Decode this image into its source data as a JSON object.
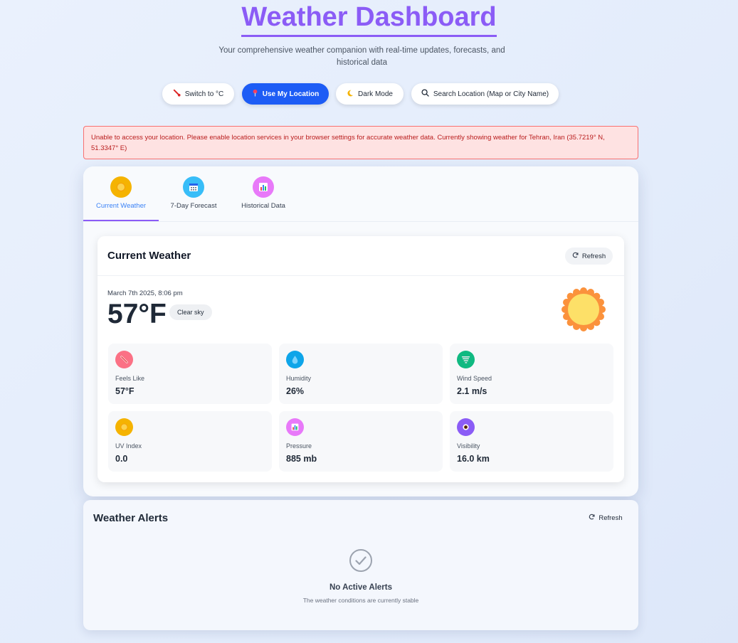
{
  "header": {
    "title": "Weather Dashboard",
    "subtitle": "Your comprehensive weather companion with real-time updates, forecasts, and historical data"
  },
  "toolbar": {
    "switch_unit_label": "Switch to °C",
    "use_location_label": "Use My Location",
    "dark_mode_label": "Dark Mode",
    "search_label": "Search Location (Map or City Name)"
  },
  "error_message": "Unable to access your location. Please enable location services in your browser settings for accurate weather data. Currently showing weather for Tehran, Iran (35.7219° N, 51.3347° E)",
  "tabs": [
    {
      "label": "Current Weather",
      "icon": "sun-icon",
      "active": true
    },
    {
      "label": "7-Day Forecast",
      "icon": "calendar-icon",
      "active": false
    },
    {
      "label": "Historical Data",
      "icon": "bar-chart-icon",
      "active": false
    }
  ],
  "current": {
    "title": "Current Weather",
    "refresh_label": "Refresh",
    "datetime": "March 7th 2025, 8:06 pm",
    "temperature": "57°F",
    "condition": "Clear sky",
    "stats": [
      {
        "label": "Feels Like",
        "value": "57°F",
        "icon": "thermometer-icon"
      },
      {
        "label": "Humidity",
        "value": "26%",
        "icon": "droplet-icon"
      },
      {
        "label": "Wind Speed",
        "value": "2.1 m/s",
        "icon": "tornado-icon"
      },
      {
        "label": "UV Index",
        "value": "0.0",
        "icon": "sun-icon"
      },
      {
        "label": "Pressure",
        "value": "885 mb",
        "icon": "bar-chart-icon"
      },
      {
        "label": "Visibility",
        "value": "16.0 km",
        "icon": "eye-icon"
      }
    ]
  },
  "alerts": {
    "title": "Weather Alerts",
    "refresh_label": "Refresh",
    "empty_title": "No Active Alerts",
    "empty_subtitle": "The weather conditions are currently stable"
  },
  "colors": {
    "accent": "#8b5cf6",
    "primary_button": "#1d5cf5",
    "error_bg": "#fee2e2",
    "error_text": "#b91c1c",
    "sun": "#fcd34d"
  }
}
